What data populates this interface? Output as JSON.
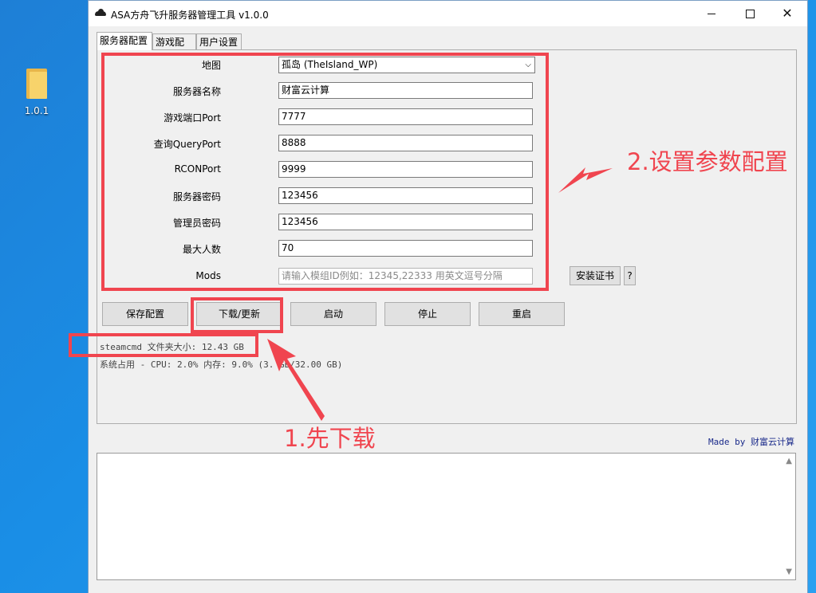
{
  "desktop": {
    "folder_label": "1.0.1"
  },
  "window": {
    "title": "ASA方舟飞升服务器管理工具 v1.0.0"
  },
  "tabs": [
    "服务器配置",
    "游戏配置",
    "用户设置"
  ],
  "form": {
    "map": {
      "label": "地图",
      "value": "孤岛 (TheIsland_WP)"
    },
    "server_name": {
      "label": "服务器名称",
      "value": "财富云计算"
    },
    "game_port": {
      "label": "游戏端口Port",
      "value": "7777"
    },
    "query_port": {
      "label": "查询QueryPort",
      "value": "8888"
    },
    "rcon_port": {
      "label": "RCONPort",
      "value": "9999"
    },
    "server_password": {
      "label": "服务器密码",
      "value": "123456"
    },
    "admin_password": {
      "label": "管理员密码",
      "value": "123456"
    },
    "max_players": {
      "label": "最大人数",
      "value": "70"
    },
    "mods": {
      "label": "Mods",
      "placeholder": "请输入模组ID例如：12345,22333  用英文逗号分隔"
    }
  },
  "buttons": {
    "install_cert": "安装证书",
    "help": "?",
    "save": "保存配置",
    "download": "下载/更新",
    "start": "启动",
    "stop": "停止",
    "restart": "重启"
  },
  "status": {
    "steamcmd": "steamcmd 文件夹大小: 12.43 GB",
    "system": "系统占用 - CPU: 2.0%  内存: 9.0% (3.  GB/32.00 GB)"
  },
  "made_by": "Made by 财富云计算",
  "annotations": {
    "step1": "1.先下载",
    "step2": "2.设置参数配置"
  },
  "colors": {
    "annotation_red": "#f0454f",
    "desktop_blue": "#1a8ee6"
  }
}
